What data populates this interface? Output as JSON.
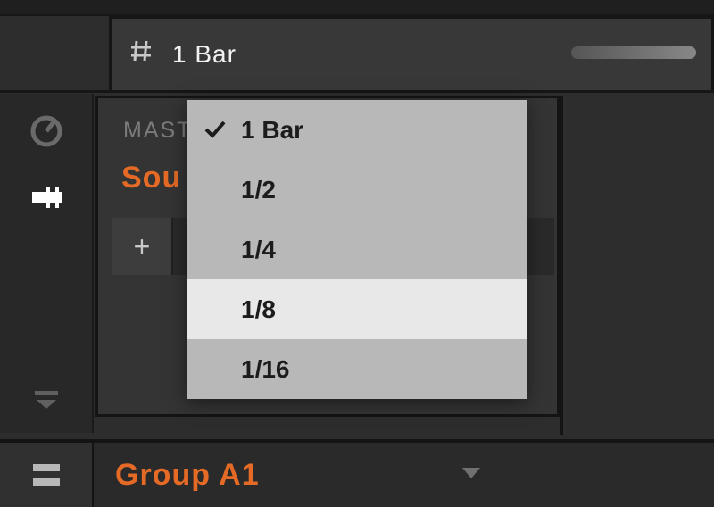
{
  "grid": {
    "value": "1 Bar"
  },
  "channel": {
    "master_label": "MAST",
    "sound_label": "Sou",
    "plus_label": "+"
  },
  "group": {
    "label": "Group A1"
  },
  "dropdown": {
    "items": [
      {
        "label": "1 Bar",
        "selected": true,
        "hover": false
      },
      {
        "label": "1/2",
        "selected": false,
        "hover": false
      },
      {
        "label": "1/4",
        "selected": false,
        "hover": false
      },
      {
        "label": "1/8",
        "selected": false,
        "hover": true
      },
      {
        "label": "1/16",
        "selected": false,
        "hover": false
      }
    ]
  }
}
